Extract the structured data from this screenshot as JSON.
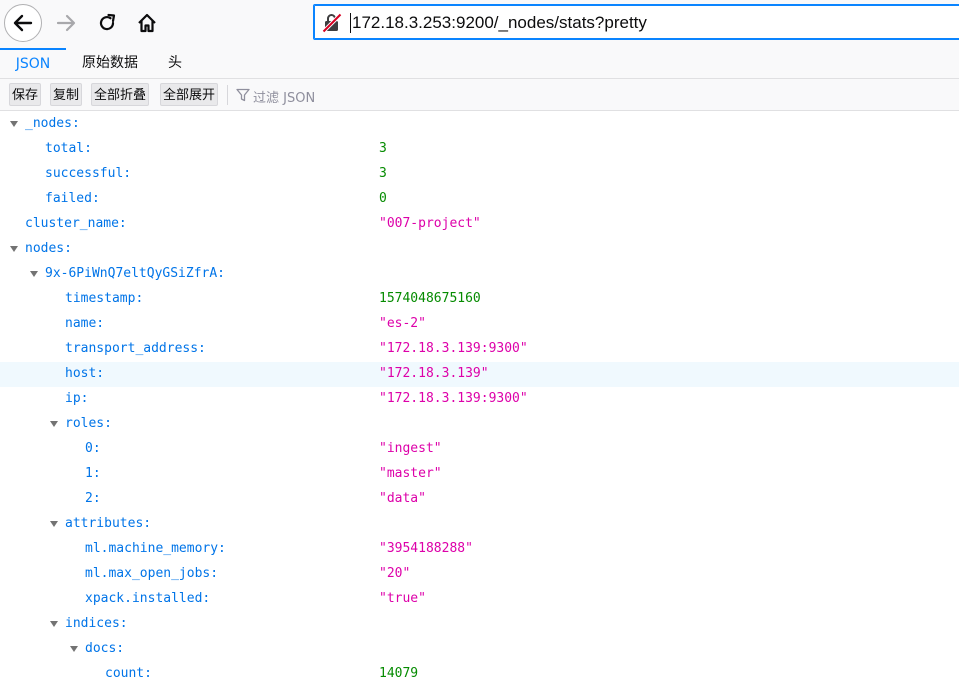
{
  "browser": {
    "url": "172.18.3.253:9200/_nodes/stats?pretty",
    "nav": {
      "back": "back-arrow-icon",
      "forward": "forward-arrow-icon",
      "reload": "reload-icon",
      "home": "home-icon"
    },
    "security_icon": "insecure-lock-icon"
  },
  "viewer": {
    "tabs": [
      {
        "label": "JSON",
        "active": true
      },
      {
        "label": "原始数据",
        "active": false
      },
      {
        "label": "头",
        "active": false
      }
    ],
    "buttons": {
      "save": "保存",
      "copy": "复制",
      "collapse_all": "全部折叠",
      "expand_all": "全部展开"
    },
    "filter_placeholder": "过滤 JSON"
  },
  "colors": {
    "key": "#0074e8",
    "number": "#058b00",
    "string": "#dd00a9",
    "accent": "#0a84ff"
  },
  "json_rows": [
    {
      "key": "_nodes:",
      "value": "",
      "type": "object",
      "expanded": true
    },
    {
      "key": "total:",
      "value": "3",
      "type": "number"
    },
    {
      "key": "successful:",
      "value": "3",
      "type": "number"
    },
    {
      "key": "failed:",
      "value": "0",
      "type": "number"
    },
    {
      "key": "cluster_name:",
      "value": "\"007-project\"",
      "type": "string"
    },
    {
      "key": "nodes:",
      "value": "",
      "type": "object",
      "expanded": true
    },
    {
      "key": "9x-6PiWnQ7eltQyGSiZfrA:",
      "value": "",
      "type": "object",
      "expanded": true
    },
    {
      "key": "timestamp:",
      "value": "1574048675160",
      "type": "number"
    },
    {
      "key": "name:",
      "value": "\"es-2\"",
      "type": "string"
    },
    {
      "key": "transport_address:",
      "value": "\"172.18.3.139:9300\"",
      "type": "string"
    },
    {
      "key": "host:",
      "value": "\"172.18.3.139\"",
      "type": "string",
      "highlighted": true
    },
    {
      "key": "ip:",
      "value": "\"172.18.3.139:9300\"",
      "type": "string"
    },
    {
      "key": "roles:",
      "value": "",
      "type": "array",
      "expanded": true
    },
    {
      "key": "0:",
      "value": "\"ingest\"",
      "type": "string"
    },
    {
      "key": "1:",
      "value": "\"master\"",
      "type": "string"
    },
    {
      "key": "2:",
      "value": "\"data\"",
      "type": "string"
    },
    {
      "key": "attributes:",
      "value": "",
      "type": "object",
      "expanded": true
    },
    {
      "key": "ml.machine_memory:",
      "value": "\"3954188288\"",
      "type": "string"
    },
    {
      "key": "ml.max_open_jobs:",
      "value": "\"20\"",
      "type": "string"
    },
    {
      "key": "xpack.installed:",
      "value": "\"true\"",
      "type": "string"
    },
    {
      "key": "indices:",
      "value": "",
      "type": "object",
      "expanded": true
    },
    {
      "key": "docs:",
      "value": "",
      "type": "object",
      "expanded": true
    },
    {
      "key": "count:",
      "value": "14079",
      "type": "number"
    }
  ]
}
